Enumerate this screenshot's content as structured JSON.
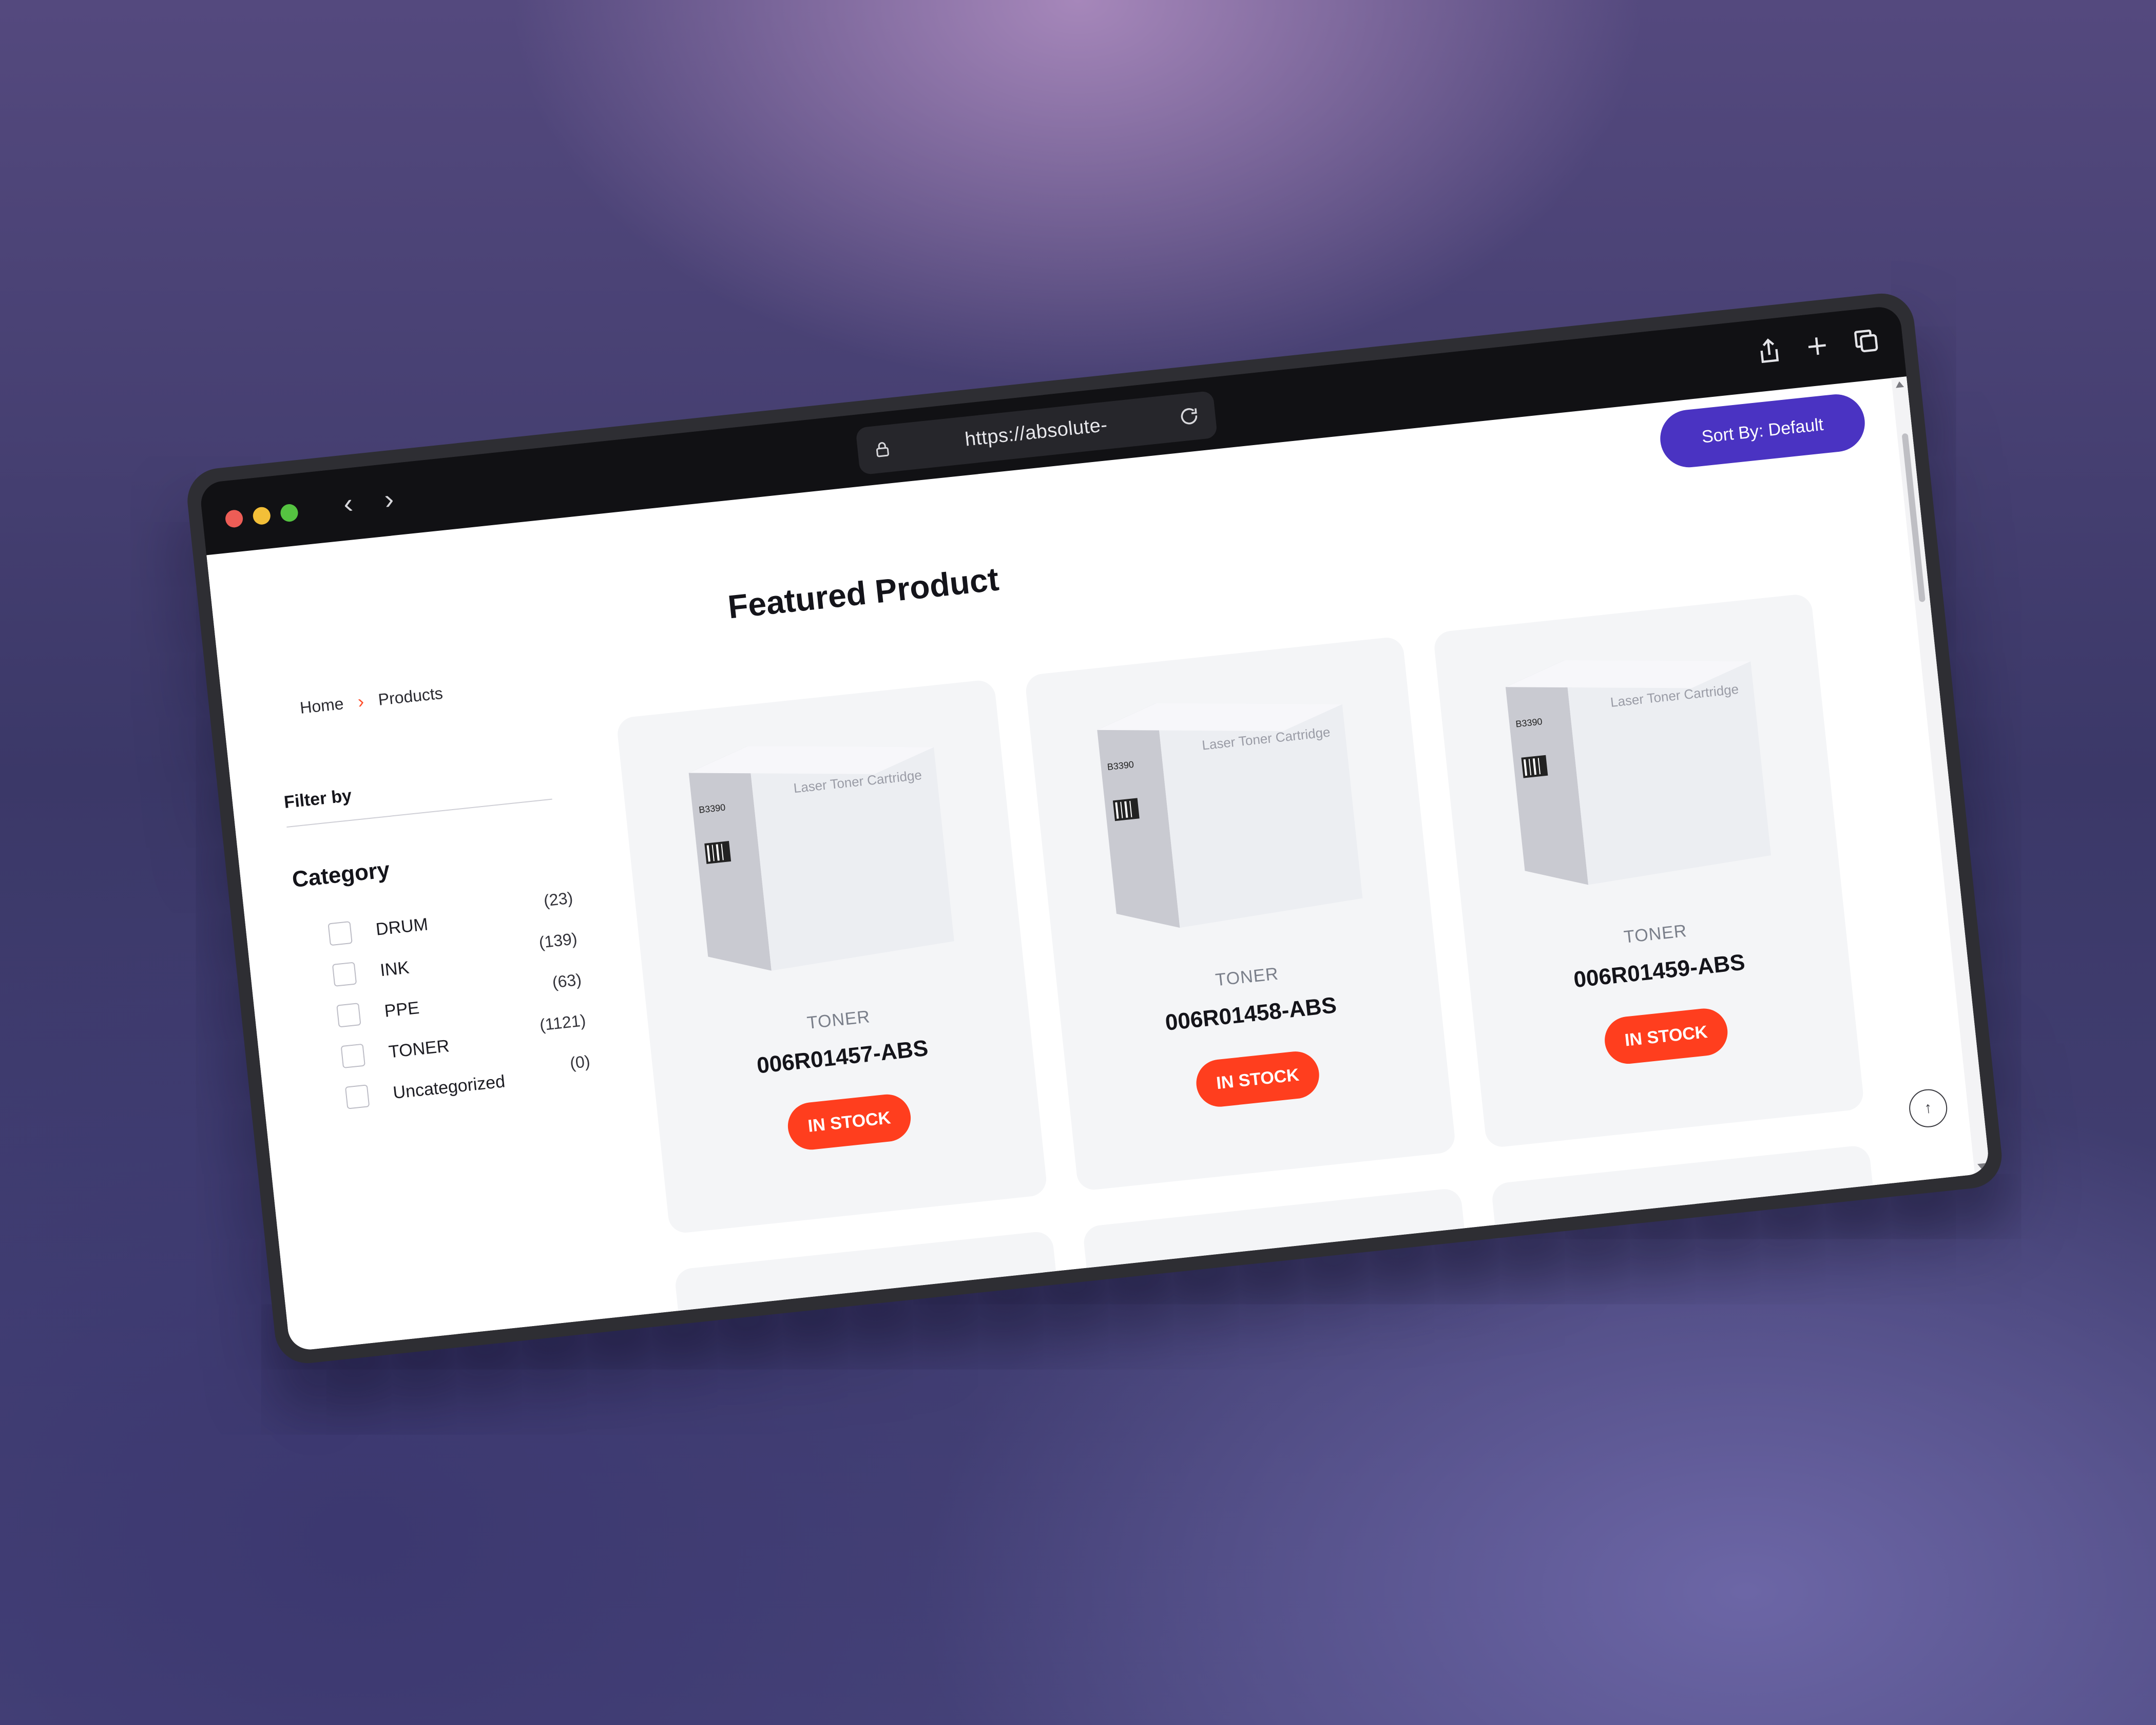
{
  "browser": {
    "url": "https://absolute-",
    "icons": [
      "back-icon",
      "forward-icon",
      "lock-icon",
      "reload-icon",
      "share-icon",
      "plus-icon",
      "tabs-icon"
    ]
  },
  "header": {
    "sort_label": "Sort By: Default",
    "title": "Featured Product"
  },
  "breadcrumb": {
    "home": "Home",
    "separator": "›",
    "current": "Products"
  },
  "sidebar": {
    "filter_label": "Filter by",
    "category_title": "Category",
    "categories": [
      {
        "name": "DRUM",
        "count": "(23)"
      },
      {
        "name": "INK",
        "count": "(139)"
      },
      {
        "name": "PPE",
        "count": "(63)"
      },
      {
        "name": "TONER",
        "count": "(1121)"
      },
      {
        "name": "Uncategorized",
        "count": "(0)"
      }
    ]
  },
  "products": [
    {
      "category": "TONER",
      "name": "006R01457-ABS",
      "stock": "IN STOCK",
      "box_text": "Laser Toner Cartridge",
      "box_code": "B3390"
    },
    {
      "category": "TONER",
      "name": "006R01458-ABS",
      "stock": "IN STOCK",
      "box_text": "Laser Toner Cartridge",
      "box_code": "B3390"
    },
    {
      "category": "TONER",
      "name": "006R01459-ABS",
      "stock": "IN STOCK",
      "box_text": "Laser Toner Cartridge",
      "box_code": "B3390"
    }
  ],
  "colors": {
    "accent": "#4a33c2",
    "stock_badge": "#ff3e1e",
    "breadcrumb_sep": "#ff4e2a"
  }
}
